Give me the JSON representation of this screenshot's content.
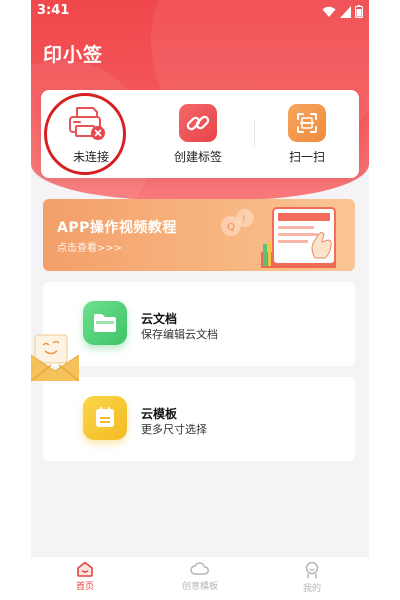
{
  "status": {
    "time": "3:41"
  },
  "header": {
    "title": "印小签"
  },
  "actions": [
    {
      "label": "未连接",
      "icon": "printer-disconnected-icon"
    },
    {
      "label": "创建标签",
      "icon": "link-tag-icon"
    },
    {
      "label": "扫一扫",
      "icon": "scan-icon"
    }
  ],
  "banner": {
    "title": "APP操作视频教程",
    "subtitle": "点击查看>>>"
  },
  "features": [
    {
      "title": "云文档",
      "subtitle": "保存编辑云文档",
      "icon": "folder-icon",
      "color": "#4fd27a"
    },
    {
      "title": "云模板",
      "subtitle": "更多尺寸选择",
      "icon": "template-icon",
      "color": "#f8c93a"
    }
  ],
  "tabs": [
    {
      "label": "首页",
      "icon": "home-icon",
      "active": true
    },
    {
      "label": "创意模板",
      "icon": "cloud-icon",
      "active": false
    },
    {
      "label": "我的",
      "icon": "profile-icon",
      "active": false
    }
  ],
  "colors": {
    "brand": "#f0474c",
    "ring": "#d71f22",
    "active_tab": "#e2453f"
  }
}
